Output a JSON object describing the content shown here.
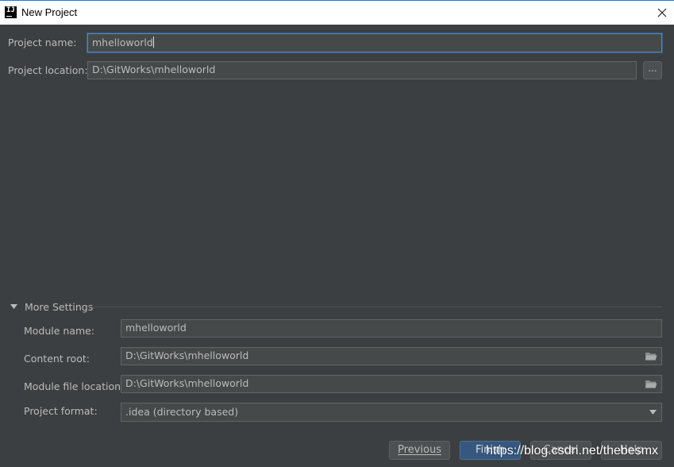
{
  "window": {
    "title": "New Project",
    "app_icon_text": "IJ",
    "close_icon": "close-icon"
  },
  "project": {
    "name_label": "Project name:",
    "name_value": "mhelloworld",
    "location_label": "Project location:",
    "location_value": "D:\\GitWorks\\mhelloworld",
    "browse_label": "..."
  },
  "more_settings": {
    "title": "More Settings",
    "module_name_label": "Module name:",
    "module_name_value": "mhelloworld",
    "content_root_label": "Content root:",
    "content_root_value": "D:\\GitWorks\\mhelloworld",
    "module_file_label": "Module file location:",
    "module_file_value": "D:\\GitWorks\\mhelloworld",
    "format_label": "Project format:",
    "format_value": ".idea (directory based)"
  },
  "buttons": {
    "previous": "Previous",
    "finish": "Finish",
    "cancel": "Cancel",
    "help": "Help"
  },
  "watermark": "https://blog.csdn.net/thebesmx",
  "colors": {
    "background": "#3c3f41",
    "field_bg": "#45494a",
    "focus_border": "#4a88c7",
    "default_button": "#365880"
  }
}
